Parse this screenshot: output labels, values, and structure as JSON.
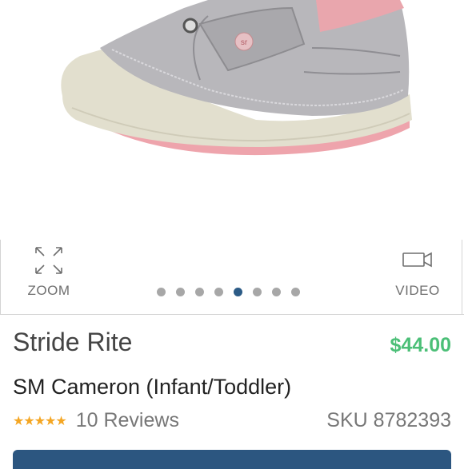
{
  "gallery": {
    "zoom_label": "ZOOM",
    "video_label": "VIDEO",
    "total_images": 8,
    "active_image_index": 5,
    "image_alt": "Stride Rite SM Cameron silver leather shoe with pink strap"
  },
  "product": {
    "brand": "Stride Rite",
    "price": "$44.00",
    "name": "SM Cameron (Infant/Toddler)",
    "rating_stars": "★★★★★",
    "reviews": "10 Reviews",
    "sku_label": "SKU",
    "sku_value": "8782393"
  },
  "colors": {
    "price": "#4bbf77",
    "active_dot": "#2c5b86",
    "inactive_dot": "#a7a7a7",
    "stars": "#f4a623",
    "cta": "#2c5680"
  }
}
